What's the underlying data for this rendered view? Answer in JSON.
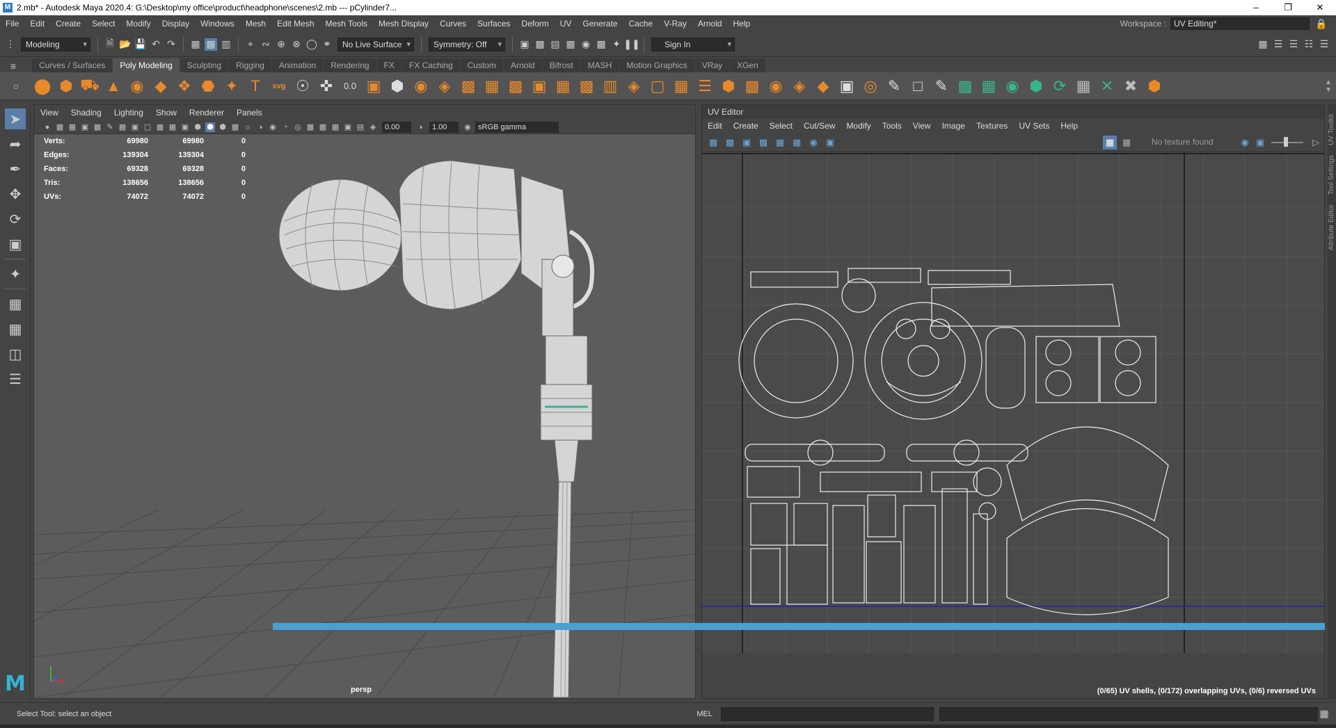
{
  "window": {
    "title": "2.mb* - Autodesk Maya 2020.4: G:\\Desktop\\my office\\product\\headphone\\scenes\\2.mb   ---   pCylinder7...",
    "app_icon_letter": "M"
  },
  "menubar": {
    "items": [
      "File",
      "Edit",
      "Create",
      "Select",
      "Modify",
      "Display",
      "Windows",
      "Mesh",
      "Edit Mesh",
      "Mesh Tools",
      "Mesh Display",
      "Curves",
      "Surfaces",
      "Deform",
      "UV",
      "Generate",
      "Cache",
      "V-Ray",
      "Arnold",
      "Help"
    ],
    "workspace_label": "Workspace :",
    "workspace_value": "UV Editing*"
  },
  "statusline": {
    "mode": "Modeling",
    "live_surface": "No Live Surface",
    "symmetry": "Symmetry: Off",
    "sign_in": "Sign In"
  },
  "shelf": {
    "tabs": [
      "Curves / Surfaces",
      "Poly Modeling",
      "Sculpting",
      "Rigging",
      "Animation",
      "Rendering",
      "FX",
      "FX Caching",
      "Custom",
      "Arnold",
      "Bifrost",
      "MASH",
      "Motion Graphics",
      "VRay",
      "XGen"
    ],
    "active_tab": "Poly Modeling"
  },
  "viewport": {
    "menu": [
      "View",
      "Shading",
      "Lighting",
      "Show",
      "Renderer",
      "Panels"
    ],
    "field_near": "0.00",
    "field_exposure": "1.00",
    "color_space": "sRGB gamma",
    "camera_label": "persp",
    "hud": [
      {
        "label": "Verts:",
        "total": "69980",
        "sel": "69980",
        "comp": "0"
      },
      {
        "label": "Edges:",
        "total": "139304",
        "sel": "139304",
        "comp": "0"
      },
      {
        "label": "Faces:",
        "total": "69328",
        "sel": "69328",
        "comp": "0"
      },
      {
        "label": "Tris:",
        "total": "138656",
        "sel": "138656",
        "comp": "0"
      },
      {
        "label": "UVs:",
        "total": "74072",
        "sel": "74072",
        "comp": "0"
      }
    ]
  },
  "uv_editor": {
    "title": "UV Editor",
    "menu": [
      "Edit",
      "Create",
      "Select",
      "Cut/Sew",
      "Modify",
      "Tools",
      "View",
      "Image",
      "Textures",
      "UV Sets",
      "Help"
    ],
    "texture_status": "No texture found",
    "info": "(0/65) UV shells, (0/172) overlapping UVs, (0/6) reversed UVs"
  },
  "right_dock": [
    "UV Toolkit",
    "Tool Settings",
    "Attribute Editor"
  ],
  "helpline": {
    "text": "Select Tool: select an object",
    "script_type": "MEL"
  },
  "colors": {
    "accent": "#5a7fa8",
    "shelf_orange": "#e8892a",
    "timeline_blue": "#4aa0d0",
    "uv_baseline": "#2222aa"
  }
}
